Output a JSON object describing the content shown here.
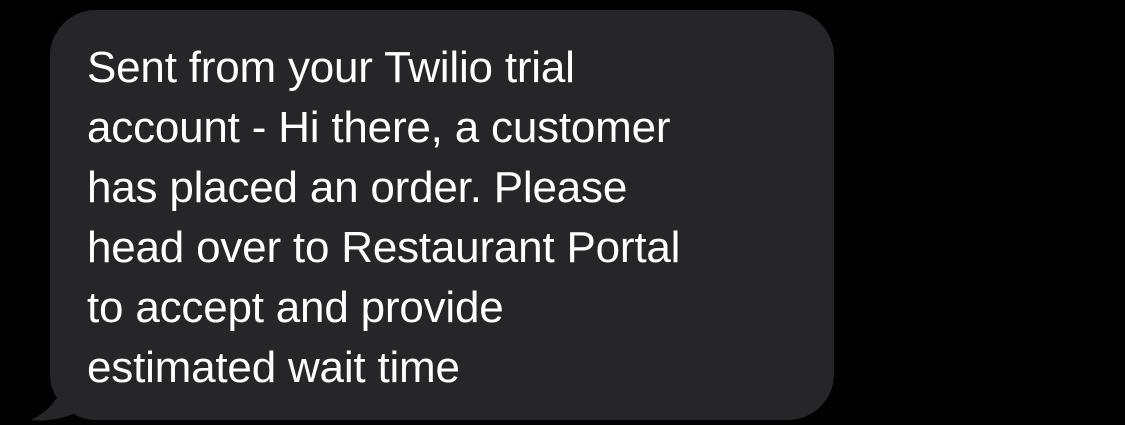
{
  "conversation": {
    "message": {
      "direction": "incoming",
      "bubble_color": "#262629",
      "text_color": "#ffffff",
      "lines": [
        "Sent from your Twilio trial",
        "account - Hi there, a customer",
        "has placed an order. Please",
        "head over to Restaurant Portal",
        "to accept and provide",
        "estimated wait time"
      ]
    }
  }
}
